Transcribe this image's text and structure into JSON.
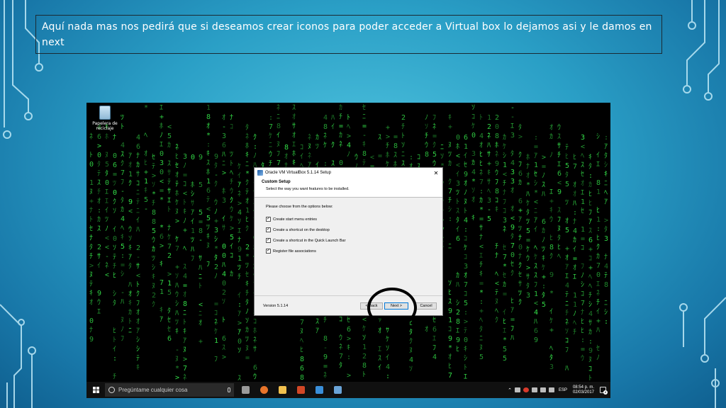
{
  "slide": {
    "caption": "Aquí nada mas nos pedirá que si deseamos crear iconos para poder acceder a Virtual box lo dejamos asi y le damos en next"
  },
  "desktop": {
    "icon_label": "Papelera de reciclaje"
  },
  "dialog": {
    "title": "Oracle VM VirtualBox 5.1.14 Setup",
    "close_glyph": "✕",
    "header_title": "Custom Setup",
    "header_subtitle": "Select the way you want features to be installed.",
    "prompt": "Please choose from the options below:",
    "options": [
      {
        "label": "Create start menu entries",
        "checked": true
      },
      {
        "label": "Create a shortcut on the desktop",
        "checked": true
      },
      {
        "label": "Create a shortcut in the Quick Launch Bar",
        "checked": true
      },
      {
        "label": "Register file associations",
        "checked": true
      }
    ],
    "check_glyph": "✓",
    "version": "Version 5.1.14",
    "back_label": "< Back",
    "next_label": "Next >",
    "cancel_label": "Cancel"
  },
  "taskbar": {
    "search_placeholder": "Pregúntame cualquier cosa",
    "apps": [
      {
        "icon": "task-view-icon",
        "color": "#9a9a9a"
      },
      {
        "icon": "firefox-icon",
        "color": "#e8742a"
      },
      {
        "icon": "file-explorer-icon",
        "color": "#f2c14e"
      },
      {
        "icon": "powerpoint-icon",
        "color": "#d24726"
      },
      {
        "icon": "mail-icon",
        "color": "#3a8fd9"
      },
      {
        "icon": "virtualbox-installer-icon",
        "color": "#6aa4d8"
      }
    ],
    "lang": "ESP",
    "time": "08:54 p. m.",
    "date": "02/03/2017",
    "notifications": "2"
  },
  "colors": {
    "matrix_green": "#35e34a",
    "slide_bg": "#2a9fc6"
  }
}
